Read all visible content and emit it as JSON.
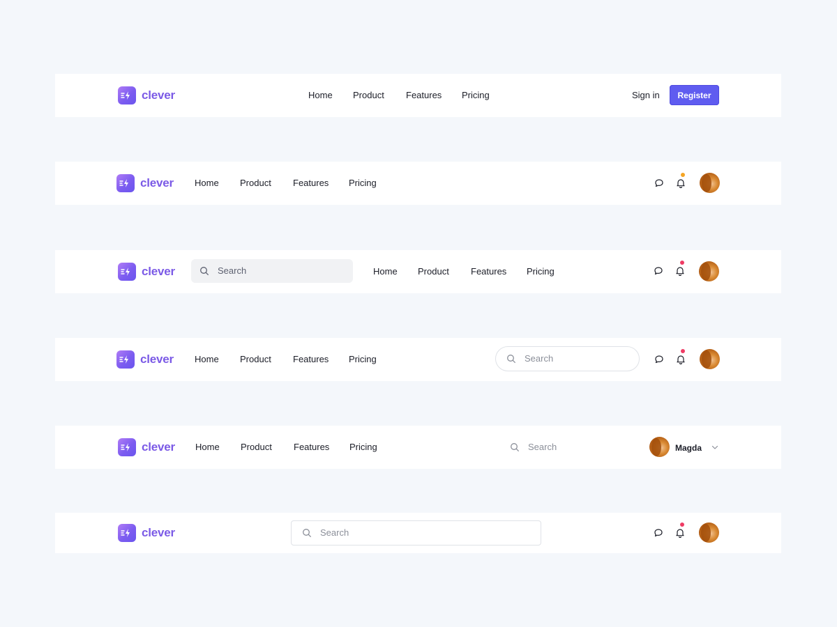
{
  "brand": {
    "name": "clever",
    "gradient_start": "#b07cf6",
    "gradient_end": "#6a55ee",
    "icon": "lightning-bolt-icon"
  },
  "nav": {
    "home": "Home",
    "product": "Product",
    "features": "Features",
    "pricing": "Pricing"
  },
  "auth": {
    "sign_in": "Sign in",
    "register": "Register",
    "register_color": "#5f5cf0"
  },
  "search": {
    "placeholder": "Search"
  },
  "user": {
    "name": "Magda"
  },
  "notification": {
    "orange_dot": "#f5a524",
    "red_dot": "#ef3b64"
  },
  "colors": {
    "background": "#f4f7fb",
    "bar": "#ffffff",
    "text": "#1b1d27",
    "muted": "#8b8f99"
  }
}
